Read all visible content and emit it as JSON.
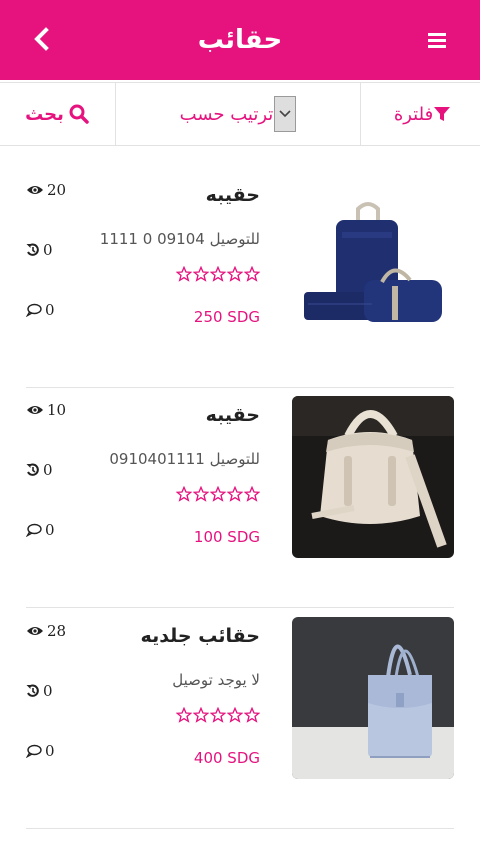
{
  "header": {
    "title": "حقائب"
  },
  "toolbar": {
    "search_label": "بحث",
    "sort_label": "ترتيب حسب",
    "filter_label": "فلترة"
  },
  "colors": {
    "accent": "#e6137f",
    "price": "#e6137f"
  },
  "products": [
    {
      "name": "حقيبه",
      "delivery": "للتوصيل 09104 0 1111",
      "price": "250 SDG",
      "views": "20",
      "shares": "0",
      "comments": "0",
      "rating": 0,
      "image": "navy-backpack-set"
    },
    {
      "name": "حقيبه",
      "delivery": "للتوصيل 0910401111",
      "price": "100 SDG",
      "views": "10",
      "shares": "0",
      "comments": "0",
      "rating": 0,
      "image": "cream-leather-bag"
    },
    {
      "name": "حقائب جلديه",
      "delivery": "لا يوجد توصيل",
      "price": "400 SDG",
      "views": "28",
      "shares": "0",
      "comments": "0",
      "rating": 0,
      "image": "light-blue-tote"
    }
  ]
}
